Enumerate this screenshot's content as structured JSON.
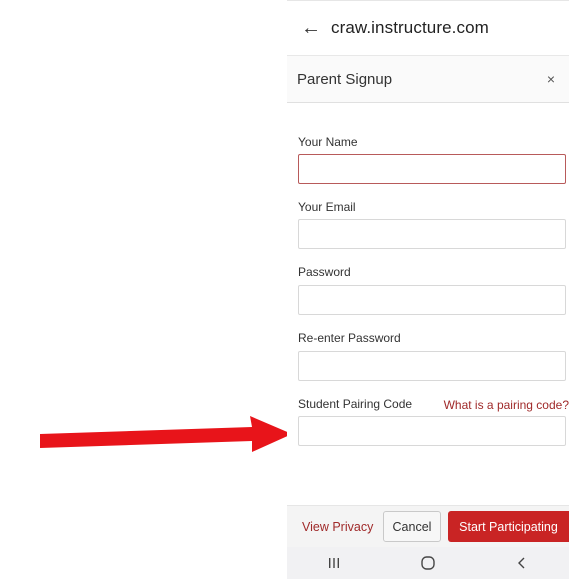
{
  "browser": {
    "url": "craw.instructure.com"
  },
  "modal": {
    "title": "Parent Signup",
    "close_glyph": "×"
  },
  "form": {
    "fields": [
      {
        "label": "Your Name",
        "value": ""
      },
      {
        "label": "Your Email",
        "value": ""
      },
      {
        "label": "Password",
        "value": ""
      },
      {
        "label": "Re-enter Password",
        "value": ""
      },
      {
        "label": "Student Pairing Code",
        "value": ""
      }
    ],
    "pairing_help_link": "What is a pairing code?"
  },
  "footer": {
    "privacy_link": "View Privacy",
    "cancel_label": "Cancel",
    "submit_label": "Start Participating"
  },
  "icons": {
    "back": "back-arrow-icon",
    "recent_apps": "recent-apps-icon",
    "home": "home-icon",
    "nav_back": "chevron-left-icon"
  },
  "colors": {
    "accent": "#c92424",
    "link": "#a02a2a",
    "focus_border": "#b85a5a",
    "annotation_arrow": "#e8141a"
  }
}
